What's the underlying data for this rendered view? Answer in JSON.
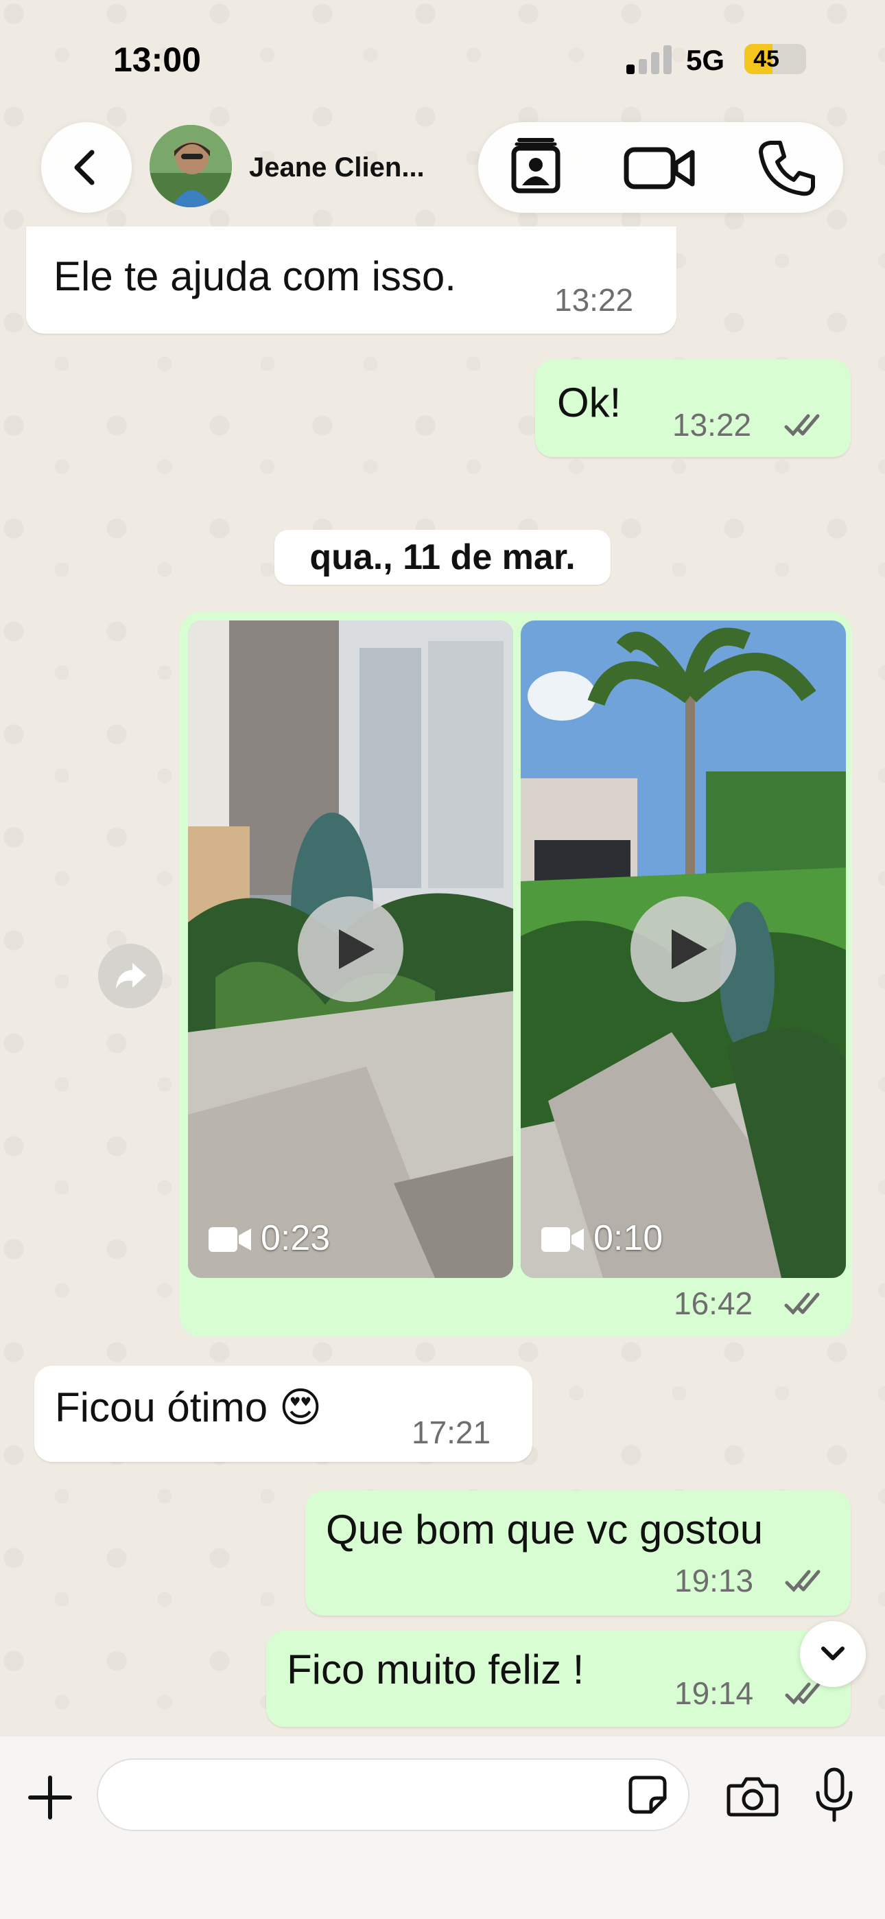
{
  "status_bar": {
    "time": "13:00",
    "network": "5G",
    "battery": "45",
    "battery_level": 0.45
  },
  "header": {
    "contact_name": "Jeane Clien...",
    "icons": [
      "chevron-left-icon",
      "contact-card-icon",
      "video-camera-icon",
      "phone-icon"
    ]
  },
  "messages": {
    "m1": {
      "text": "Ele te ajuda com isso.",
      "time": "13:22",
      "direction": "incoming"
    },
    "m2": {
      "text": "Ok!",
      "time": "13:22",
      "direction": "outgoing",
      "status": "read"
    },
    "date_separator": "qua., 11 de mar.",
    "media": {
      "video1_duration": "0:23",
      "video2_duration": "0:10",
      "time": "16:42",
      "status": "read"
    },
    "m3": {
      "text": "Ficou ótimo 😍",
      "time": "17:21",
      "direction": "incoming"
    },
    "m4": {
      "text": "Que bom que vc gostou",
      "time": "19:13",
      "direction": "outgoing",
      "status": "read"
    },
    "m5": {
      "text": "Fico muito feliz !",
      "time": "19:14",
      "direction": "outgoing",
      "status": "read"
    }
  },
  "composer": {
    "placeholder": "",
    "value": "",
    "icons": [
      "plus-icon",
      "sticker-icon",
      "camera-icon",
      "microphone-icon"
    ]
  },
  "colors": {
    "chat_background": "#efeae2",
    "outgoing_bubble": "#d9fdd3",
    "incoming_bubble": "#ffffff",
    "read_ticks": "#53bdeb",
    "battery": "#f4c51c"
  }
}
